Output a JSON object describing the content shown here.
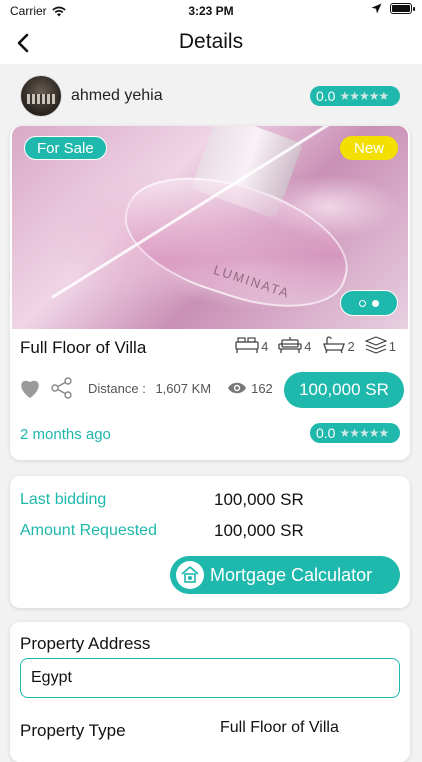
{
  "status_bar": {
    "carrier": "Carrier",
    "time": "3:23 PM"
  },
  "header": {
    "title": "Details"
  },
  "owner": {
    "name": "ahmed yehia",
    "rating": "0.0",
    "stars": "★★★★★"
  },
  "listing": {
    "sale_badge": "For Sale",
    "new_badge": "New",
    "image_brand": "LUMINATA",
    "title": "Full Floor of Villa",
    "features": [
      {
        "icon": "bed-icon",
        "count": "4"
      },
      {
        "icon": "sofa-icon",
        "count": "4"
      },
      {
        "icon": "bathtub-icon",
        "count": "2"
      },
      {
        "icon": "floors-icon",
        "count": "1"
      }
    ],
    "distance_label": "Distance :",
    "distance_value": "1,607 KM",
    "views": "162",
    "price": "100,000 SR",
    "posted": "2 months ago",
    "rating": "0.0",
    "stars": "★★★★★",
    "pager": {
      "pages": 2,
      "active": 2
    }
  },
  "bidding": {
    "last_bidding_label": "Last bidding",
    "last_bidding_value": "100,000 SR",
    "amount_requested_label": "Amount Requested",
    "amount_requested_value": "100,000 SR",
    "mortgage_button": "Mortgage Calculator"
  },
  "property": {
    "address_label": "Property Address",
    "address_value": "Egypt",
    "type_label": "Property Type",
    "type_value": "Full Floor of Villa"
  },
  "colors": {
    "accent": "#1fb8ac",
    "new_badge": "#f3e000",
    "background": "#f2f2f2"
  }
}
